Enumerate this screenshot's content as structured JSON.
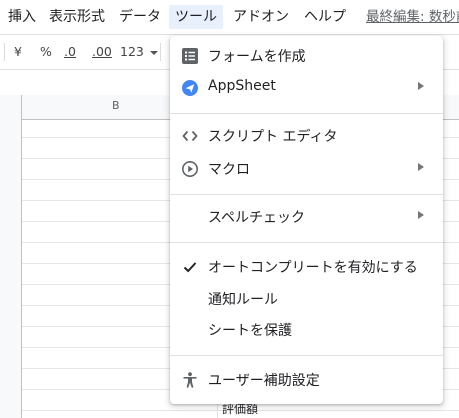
{
  "menubar": {
    "items": [
      "挿入",
      "表示形式",
      "データ",
      "ツール",
      "アドオン",
      "ヘルプ"
    ],
    "last_edit": "最終編集: 数秒前"
  },
  "toolbar": {
    "currency": "¥",
    "percent": "%",
    "dec_decrease": ".0",
    "dec_increase": ".00",
    "format": "123"
  },
  "grid": {
    "column_b": "B",
    "cell_text": "評価額"
  },
  "tools_menu": {
    "items": [
      {
        "label": "フォームを作成",
        "icon": "form-icon",
        "submenu": false
      },
      {
        "label": "AppSheet",
        "icon": "appsheet-icon",
        "submenu": true
      },
      {
        "label": "スクリプト エディタ",
        "icon": "code-icon",
        "submenu": false
      },
      {
        "label": "マクロ",
        "icon": "play-circle-icon",
        "submenu": true
      },
      {
        "label": "スペルチェック",
        "icon": "",
        "submenu": true
      },
      {
        "label": "オートコンプリートを有効にする",
        "icon": "check-icon",
        "submenu": false
      },
      {
        "label": "通知ルール",
        "icon": "",
        "submenu": false
      },
      {
        "label": "シートを保護",
        "icon": "",
        "submenu": false
      },
      {
        "label": "ユーザー補助設定",
        "icon": "accessibility-icon",
        "submenu": false
      }
    ]
  },
  "colors": {
    "active_menu_bg": "#e8f0fe",
    "appsheet_blue": "#4285f4"
  }
}
